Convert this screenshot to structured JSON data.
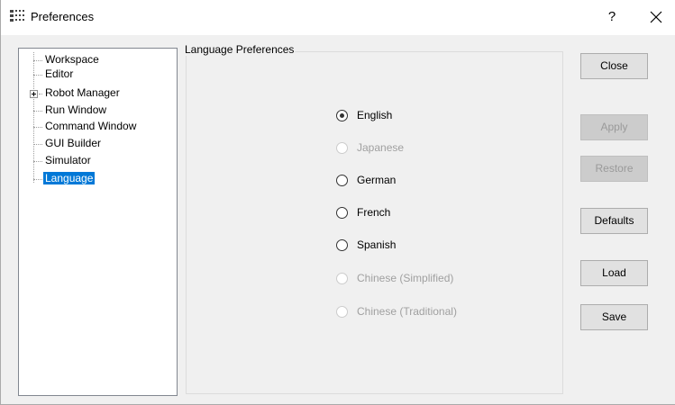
{
  "window": {
    "title": "Preferences",
    "help_label": "?",
    "close_icon": "close-icon"
  },
  "tree": {
    "items": [
      {
        "label": "Workspace"
      },
      {
        "label": "Editor"
      },
      {
        "label": "Robot Manager",
        "expandable": true
      },
      {
        "label": "Run Window"
      },
      {
        "label": "Command Window"
      },
      {
        "label": "GUI Builder"
      },
      {
        "label": "Simulator"
      },
      {
        "label": "Language",
        "selected": true
      }
    ]
  },
  "language_panel": {
    "title": "Language Preferences",
    "options": [
      {
        "label": "English",
        "checked": true,
        "enabled": true
      },
      {
        "label": "Japanese",
        "checked": false,
        "enabled": false
      },
      {
        "label": "German",
        "checked": false,
        "enabled": true
      },
      {
        "label": "French",
        "checked": false,
        "enabled": true
      },
      {
        "label": "Spanish",
        "checked": false,
        "enabled": true
      },
      {
        "label": "Chinese (Simplified)",
        "checked": false,
        "enabled": false
      },
      {
        "label": "Chinese (Traditional)",
        "checked": false,
        "enabled": false
      }
    ]
  },
  "buttons": {
    "close": {
      "label": "Close",
      "enabled": true
    },
    "apply": {
      "label": "Apply",
      "enabled": false
    },
    "restore": {
      "label": "Restore",
      "enabled": false
    },
    "defaults": {
      "label": "Defaults",
      "enabled": true
    },
    "load": {
      "label": "Load",
      "enabled": true
    },
    "save": {
      "label": "Save",
      "enabled": true
    }
  },
  "colors": {
    "selection": "#0078d7",
    "disabled_text": "#a0a0a0"
  }
}
